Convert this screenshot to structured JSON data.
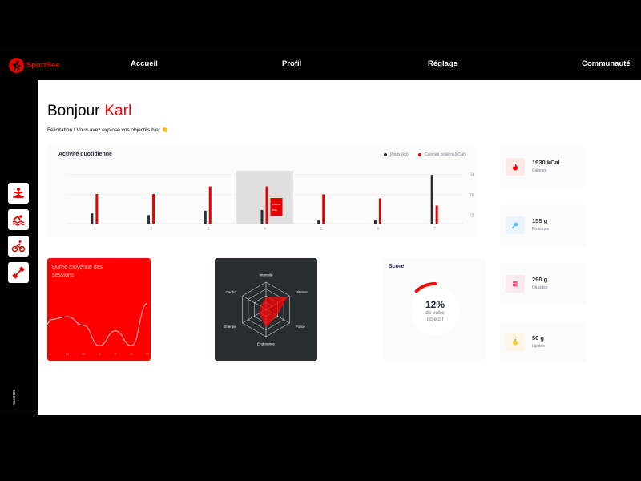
{
  "brand": {
    "name": "SportSee",
    "color": "#E60000"
  },
  "nav": [
    "Accueil",
    "Profil",
    "Réglage",
    "Communauté"
  ],
  "sidebar": {
    "icons": [
      "yoga-icon",
      "swimming-icon",
      "cycling-icon",
      "dumbbell-icon"
    ],
    "copyright": "Sas 2020"
  },
  "greeting": {
    "hello": "Bonjour",
    "name": "Karl",
    "message": "Félicitation ! Vous avez explosé vos objectifs hier 👏"
  },
  "activity": {
    "title": "Activité quotidienne",
    "legend_weight": "Poids (kg)",
    "legend_calories": "Calories brûlées (kCal)",
    "tooltip": {
      "weight": "69kg",
      "calories": "240Kcal"
    }
  },
  "sessions": {
    "title": "Durée moyenne des sessions"
  },
  "score": {
    "title": "Score",
    "percent": "12%",
    "line1": "de votre",
    "line2": "objectif"
  },
  "key_data": [
    {
      "value": "1930 kCal",
      "label": "Calories",
      "icon": "fire-icon",
      "color": "#FF0000",
      "bg": "#FBEAEA"
    },
    {
      "value": "155 g",
      "label": "Protéines",
      "icon": "chicken-icon",
      "color": "#4AB8FF",
      "bg": "#E9F4FB"
    },
    {
      "value": "290 g",
      "label": "Glucides",
      "icon": "apple-icon",
      "color": "#FD5181",
      "bg": "#FBEAEF"
    },
    {
      "value": "50 g",
      "label": "Lipides",
      "icon": "burger-icon",
      "color": "#F9CE23",
      "bg": "#FBF6E5"
    }
  ],
  "chart_data": [
    {
      "type": "bar",
      "title": "Activité quotidienne",
      "categories": [
        "1",
        "2",
        "3",
        "4",
        "5",
        "6",
        "7"
      ],
      "series": [
        {
          "name": "Poids (kg)",
          "color": "#282D30",
          "values": [
            72.5,
            72.0,
            73.3,
            73.5,
            70.4,
            70.5,
            83.8
          ]
        },
        {
          "name": "Calories brûlées (kCal)",
          "color": "#E60000",
          "values": [
            78.2,
            78.2,
            80.4,
            80.4,
            78.1,
            76.9,
            74.8
          ]
        }
      ],
      "ylim": [
        69.5,
        85
      ],
      "yticks": [
        72,
        78,
        84
      ],
      "highlight_index": 3
    },
    {
      "type": "line",
      "title": "Durée moyenne des sessions",
      "categories": [
        "L",
        "M",
        "M",
        "J",
        "V",
        "S",
        "D"
      ],
      "values": [
        0.53,
        0.49,
        0.61,
        0.9,
        0.69,
        0.9,
        0.3
      ]
    },
    {
      "type": "radar",
      "categories": [
        "Intensité",
        "Vitesse",
        "Force",
        "Endurance",
        "Energie",
        "Cardio"
      ],
      "values": [
        55,
        110,
        55,
        80,
        35,
        28
      ],
      "max": 120
    },
    {
      "type": "pie",
      "title": "Score",
      "values": [
        12,
        88
      ]
    }
  ]
}
